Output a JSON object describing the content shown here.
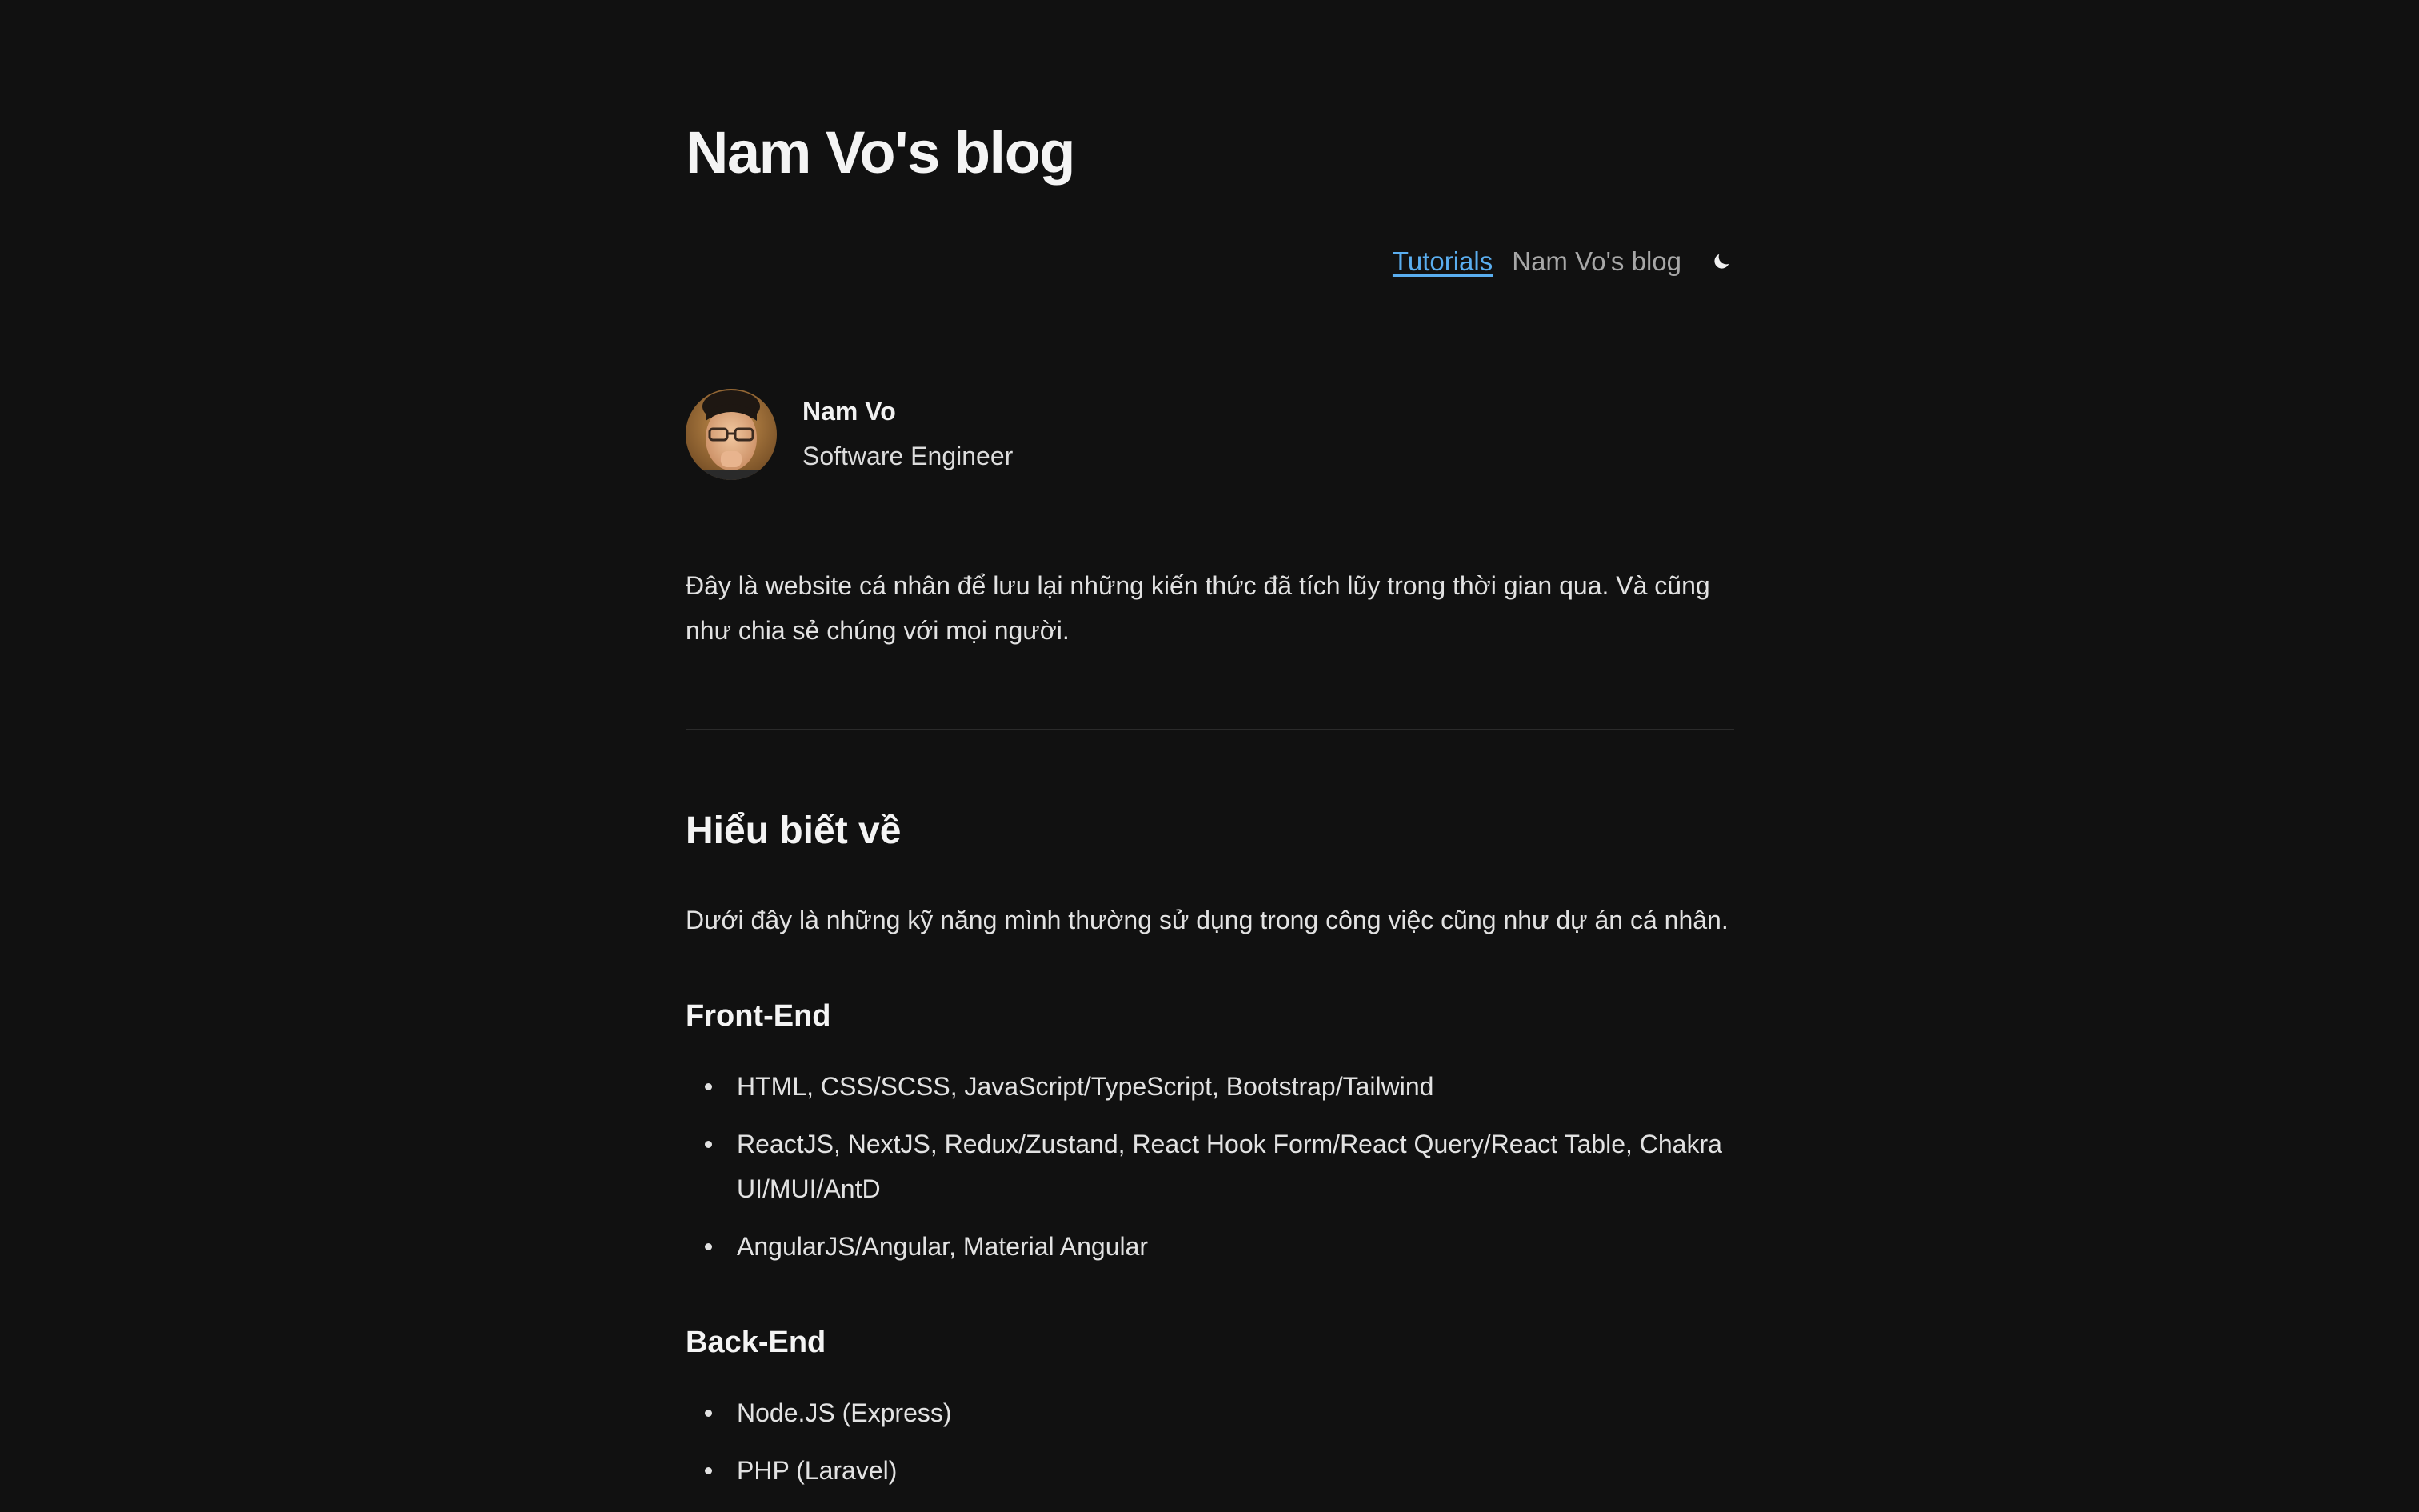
{
  "header": {
    "title": "Nam Vo's blog",
    "nav": {
      "tutorials": "Tutorials",
      "blog": "Nam Vo's blog"
    },
    "theme_icon": "moon-icon"
  },
  "profile": {
    "name": "Nam Vo",
    "role": "Software Engineer"
  },
  "intro": "Đây là website cá nhân để lưu lại những kiến thức đã tích lũy trong thời gian qua. Và cũng như chia sẻ chúng với mọi người.",
  "skills": {
    "title": "Hiểu biết về",
    "description": "Dưới đây là những kỹ năng mình thường sử dụng trong công việc cũng như dự án cá nhân.",
    "frontend": {
      "title": "Front-End",
      "items": [
        "HTML, CSS/SCSS, JavaScript/TypeScript, Bootstrap/Tailwind",
        "ReactJS, NextJS, Redux/Zustand, React Hook Form/React Query/React Table, Chakra UI/MUI/AntD",
        "AngularJS/Angular, Material Angular"
      ]
    },
    "backend": {
      "title": "Back-End",
      "items": [
        "Node.JS (Express)",
        "PHP (Laravel)"
      ]
    }
  },
  "colors": {
    "background": "#111111",
    "link": "#5aaef0",
    "text": "#e2e2e2"
  }
}
